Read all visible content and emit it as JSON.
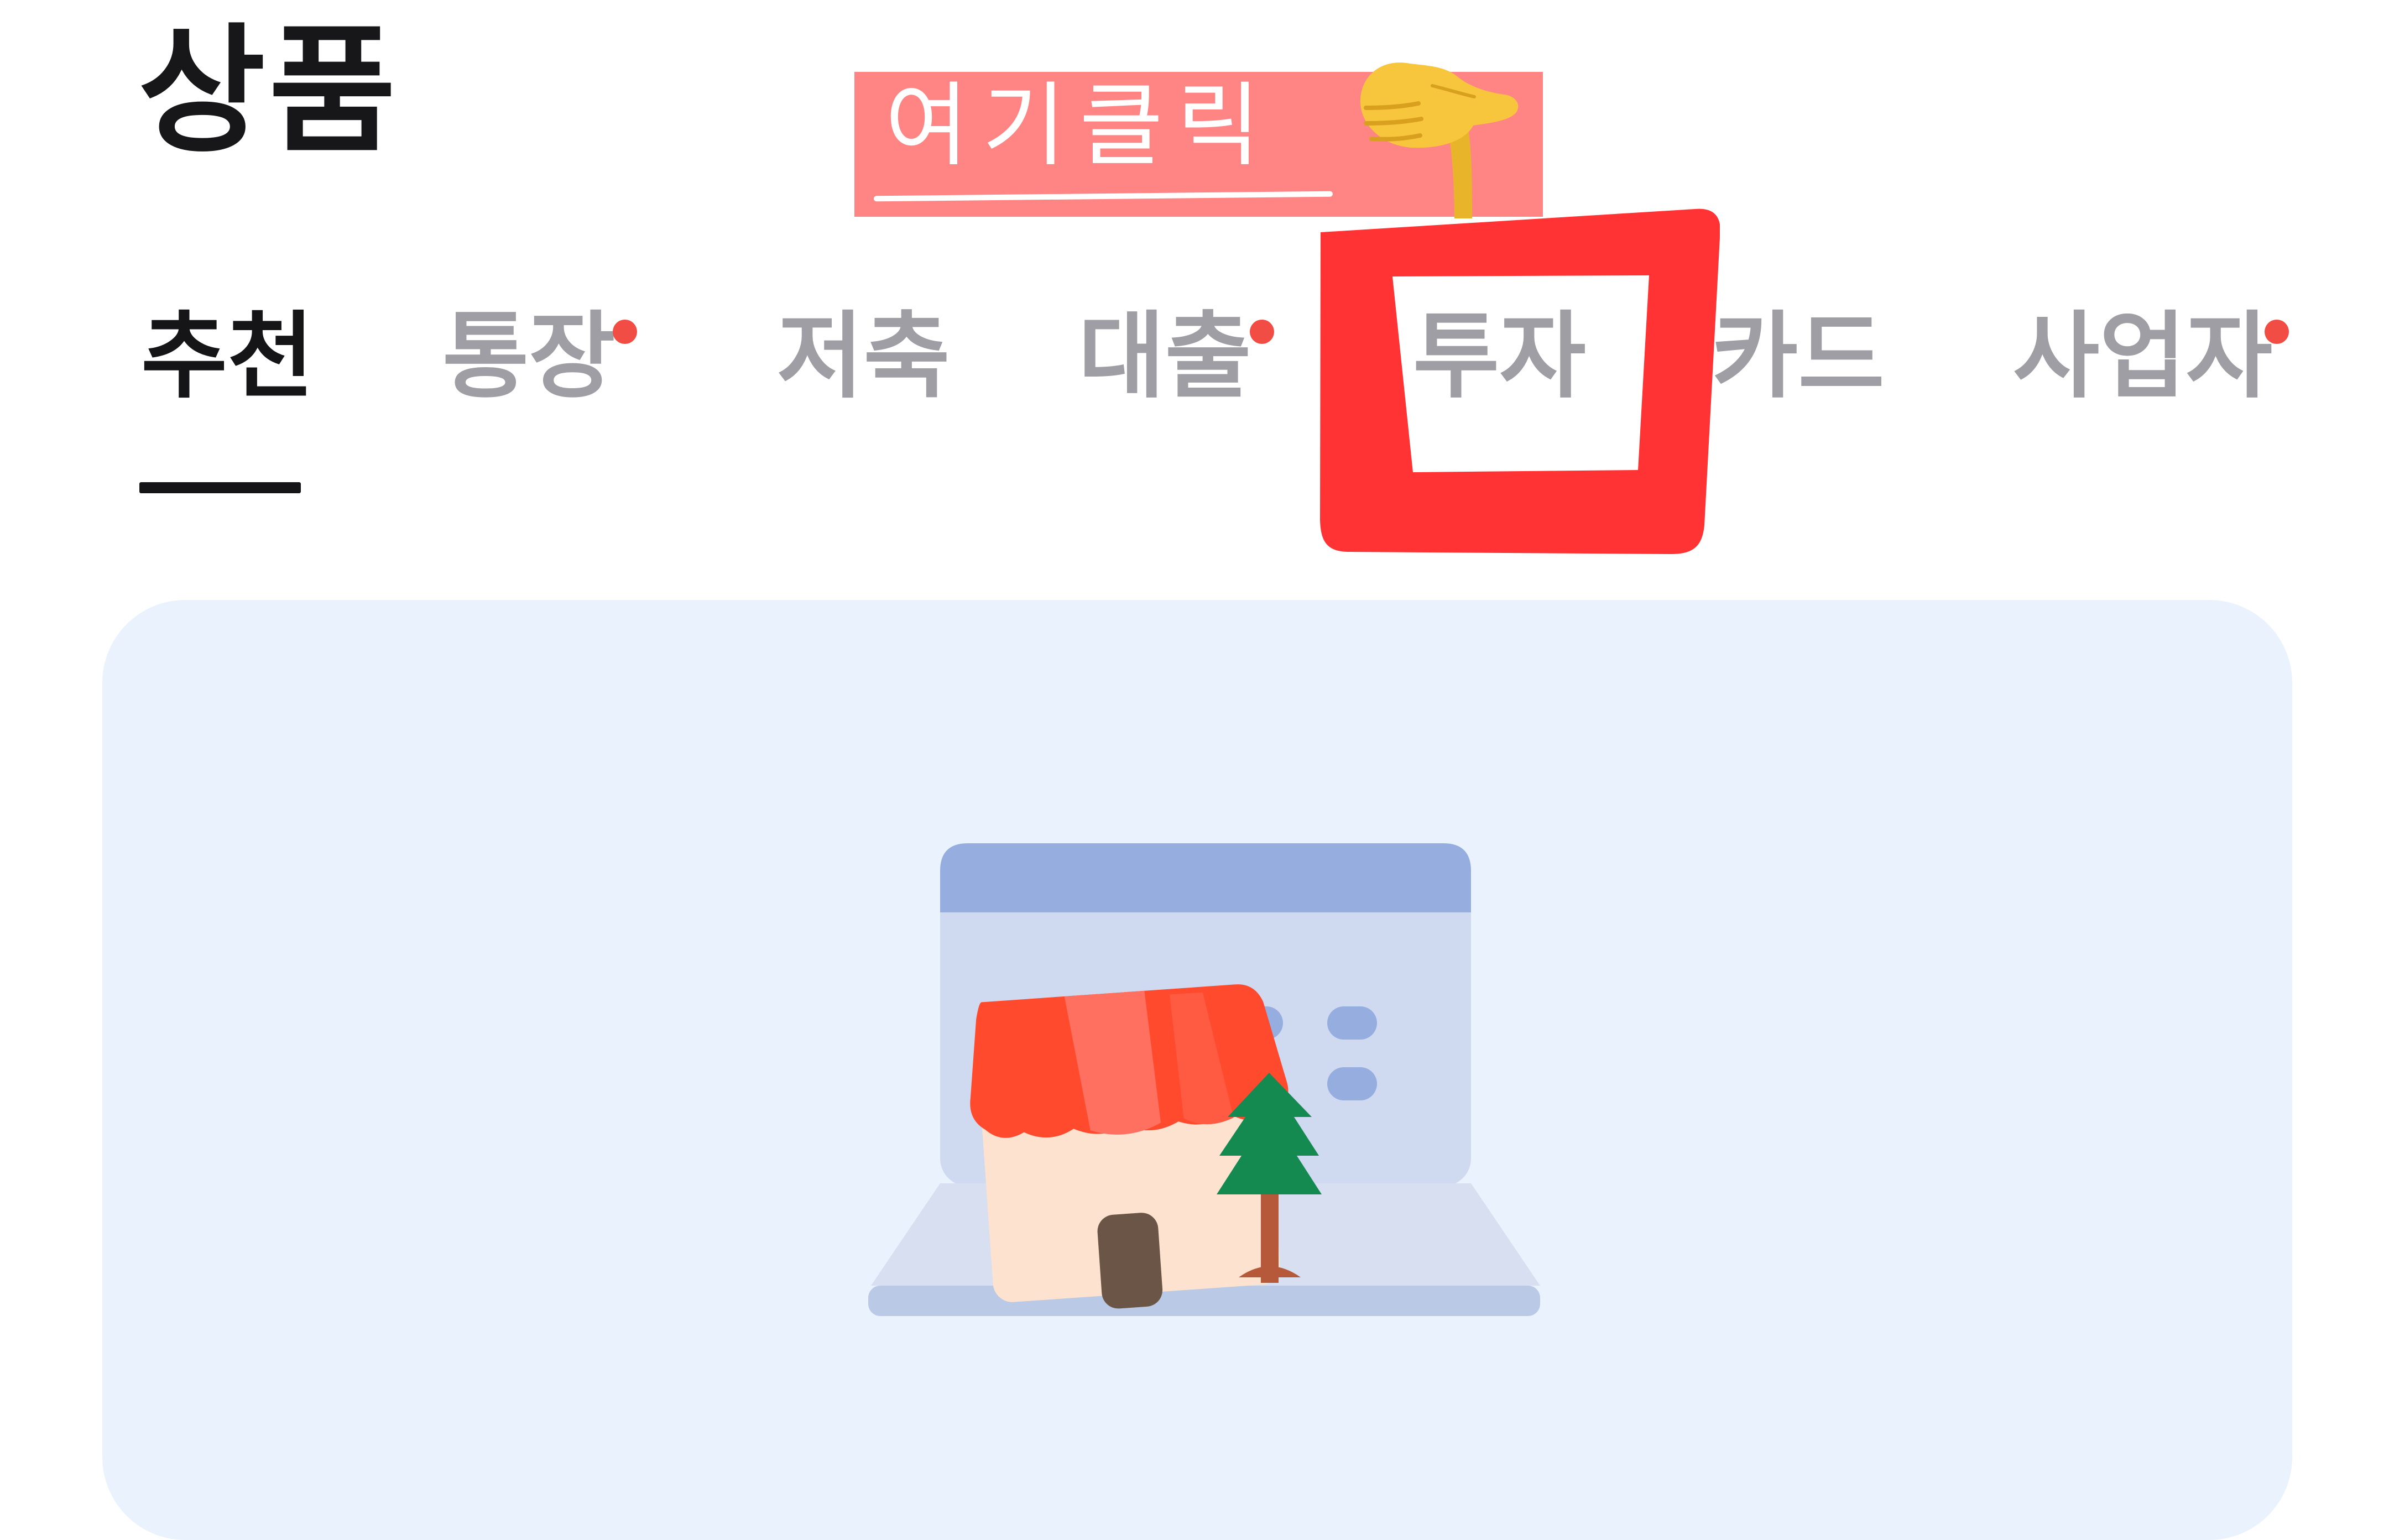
{
  "page": {
    "title": "상품"
  },
  "tabs": [
    {
      "label": "추천",
      "active": true,
      "new_dot": false
    },
    {
      "label": "통장",
      "active": false,
      "new_dot": true
    },
    {
      "label": "저축",
      "active": false,
      "new_dot": false
    },
    {
      "label": "대출",
      "active": false,
      "new_dot": true
    },
    {
      "label": "투자",
      "active": false,
      "new_dot": false
    },
    {
      "label": "카드",
      "active": false,
      "new_dot": false
    },
    {
      "label": "사업자",
      "active": false,
      "new_dot": true
    }
  ],
  "annotation": {
    "text": "여기클릭",
    "box_color": "#ff8584",
    "highlight_color": "#ff3333",
    "hand_icon": "backhand-index-pointing-down-icon"
  },
  "colors": {
    "active_text": "#151517",
    "inactive_text": "#9e9ea4",
    "new_dot": "#f14d45",
    "card_background": "#eaf2fd"
  },
  "illustration": {
    "icon": "laptop-shop-icon"
  }
}
